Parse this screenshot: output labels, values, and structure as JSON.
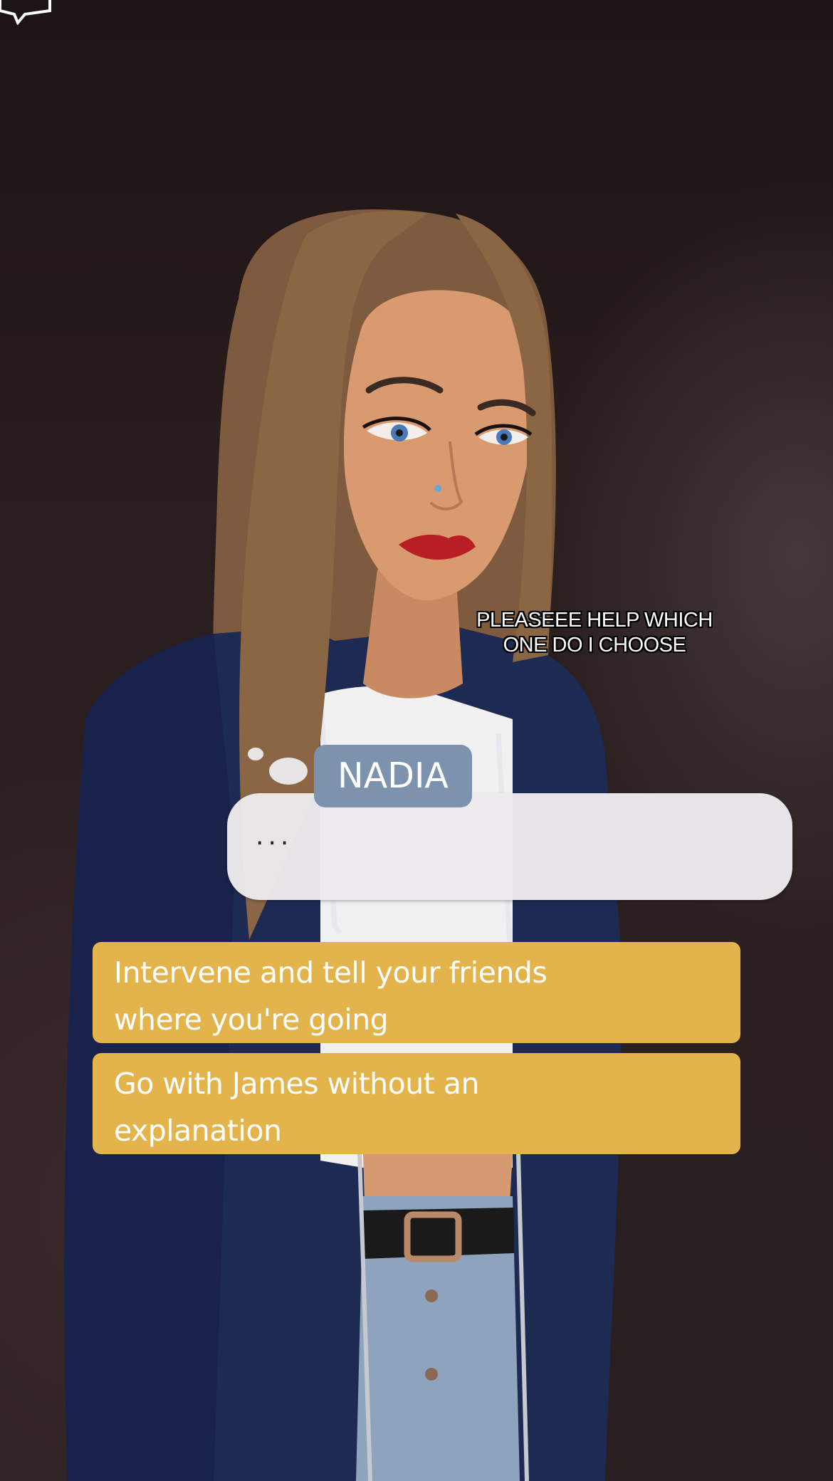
{
  "caption": {
    "text": "PLEASEEE HELP WHICH ONE DO I CHOOSE"
  },
  "dialogue": {
    "speaker": "NADIA",
    "text": "...",
    "type": "thought"
  },
  "choices": [
    {
      "label": "Intervene and tell your friends where you're going"
    },
    {
      "label": "Go with James without an explanation"
    }
  ],
  "icons": {
    "corner": "menu-box-icon"
  },
  "colors": {
    "choice_bg": "#e3b44b",
    "speaker_tag_bg": "#7d92ad",
    "bubble_bg": "#eceaec"
  }
}
